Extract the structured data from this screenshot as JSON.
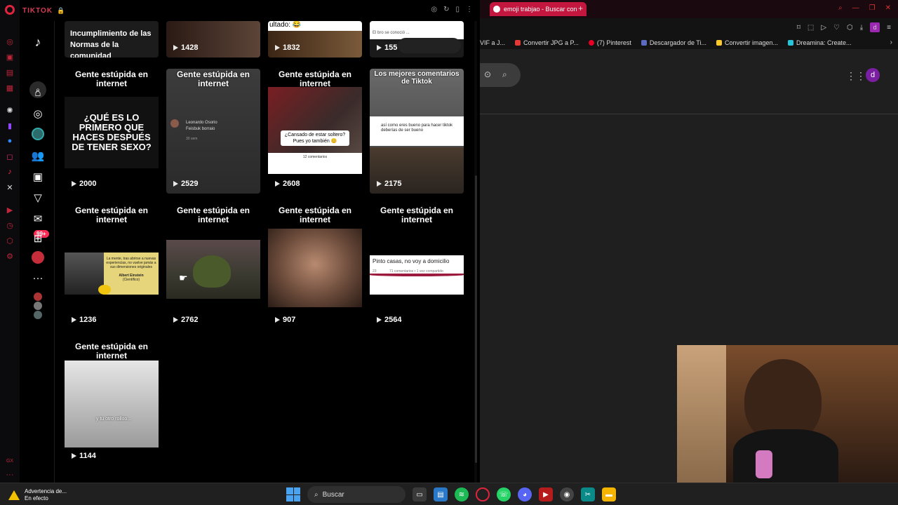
{
  "tiktok": {
    "header_title": "TIKTOK",
    "partial_top_caption": "Incumplimiento de las Normas de la comunidad",
    "top_row": [
      {
        "partial_text": "",
        "views": "1428"
      },
      {
        "partial_text": "ultado: 😂",
        "views": "1832"
      },
      {
        "partial_text": "El bro se conoció ...",
        "views": "155"
      }
    ],
    "badge": "99+",
    "cards": [
      {
        "caption": "Gente estúpida en internet",
        "views": "2000",
        "overlay": "¿QUÉ ES LO PRIMERO QUE HACES DESPUÉS DE TENER SEXO?"
      },
      {
        "caption": "Gente estúpida en internet",
        "views": "2529",
        "overlay": "Leonardo Osorio",
        "overlay2": "Feisbuk borraio",
        "overlay3": "30 sem"
      },
      {
        "caption": "Gente estúpida en internet",
        "views": "2608",
        "overlay": "¿Cansado de estar soltero?",
        "overlay2": "Pues yo también 😊",
        "overlay3": "12 comentarios"
      },
      {
        "caption": "Los mejores comentarios de Tiktok",
        "views": "2175",
        "overlay": "así como eres bueno para hacer tiktok deberías de ser bueno"
      },
      {
        "caption": "Gente estúpida en internet",
        "views": "1236",
        "overlay": "La mente, tras abrirse a nuevas experiencias, no vuelve jamás a sus dimensiones originales",
        "overlay2": "Albert Einstein",
        "overlay3": "(Científico)"
      },
      {
        "caption": "Gente estúpida en internet",
        "views": "2762",
        "overlay": ""
      },
      {
        "caption": "Gente estúpida en internet",
        "views": "907",
        "overlay": ""
      },
      {
        "caption": "Gente estúpida en internet",
        "views": "2564",
        "overlay": "Pinto casas, no voy a domicilio",
        "overlay2": "23",
        "overlay3": "71 comentarios • 1 vez compartido"
      },
      {
        "caption": "Gente estúpida en internet",
        "views": "1144",
        "overlay": "y tu otro rolloo..."
      }
    ]
  },
  "browser": {
    "tab_title": "emoji trabjao - Buscar con",
    "new_tab": "+",
    "bookmarks": [
      "VIF a J...",
      "Convertir JPG a P...",
      "(7) Pinterest",
      "Descargador de Ti...",
      "Convertir imagen...",
      "Dreamina: Create..."
    ],
    "profile_letter": "d"
  },
  "taskbar": {
    "warning_title": "Advertencia de...",
    "warning_sub": "En efecto",
    "search_placeholder": "Buscar"
  },
  "colors": {
    "opera_red": "#e0243e",
    "tiktok_pink": "#fe2c55",
    "tab_red": "#c3173f"
  }
}
